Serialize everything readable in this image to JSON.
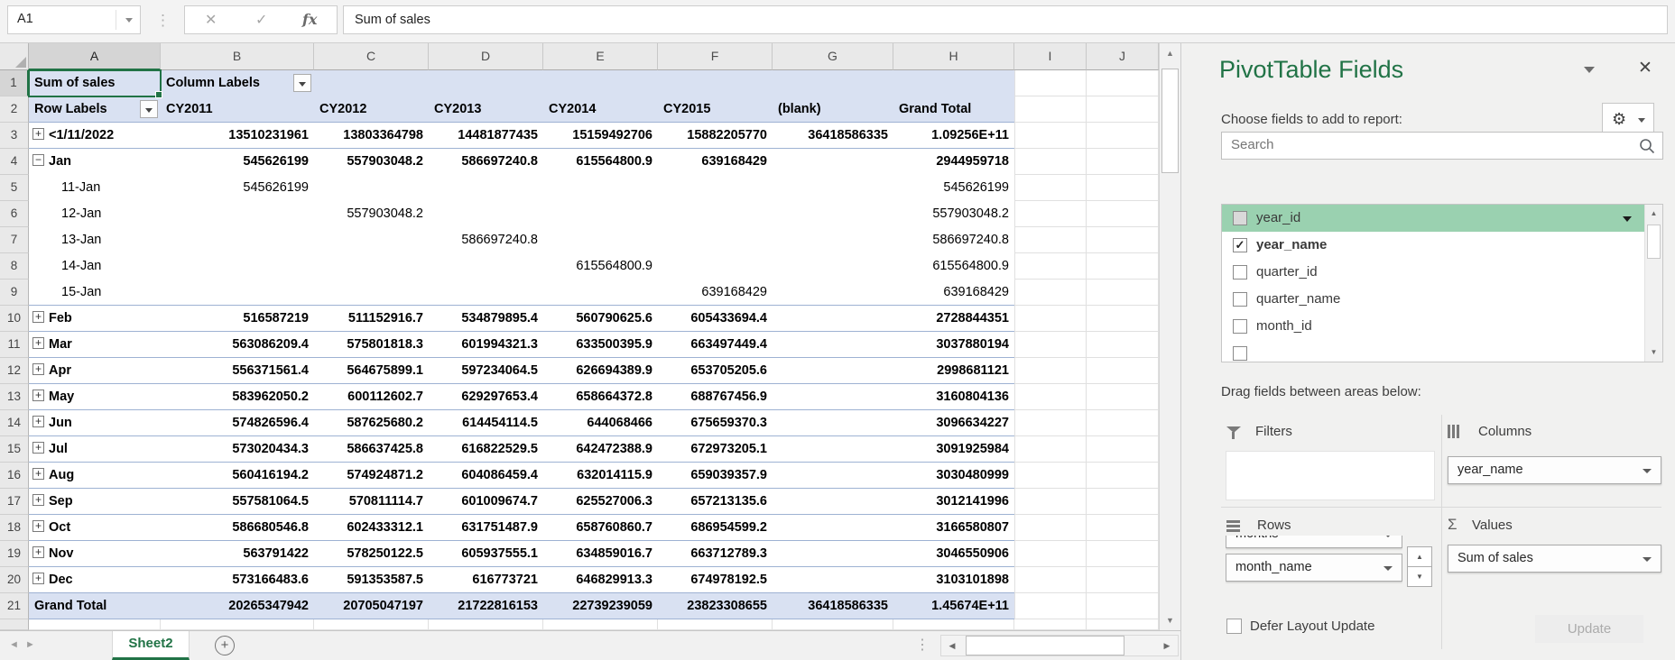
{
  "formula_bar": {
    "cell_reference": "A1",
    "formula_text": "Sum of sales",
    "fx_label": "fx"
  },
  "grid": {
    "column_letters": [
      "A",
      "B",
      "C",
      "D",
      "E",
      "F",
      "G",
      "H",
      "I",
      "J"
    ],
    "selected_column": "A",
    "selected_row": "1",
    "header_row1": {
      "row_num": "1",
      "a_value": "Sum of sales",
      "b_value": "Column Labels"
    },
    "header_row2": {
      "row_num": "2",
      "a_value": "Row Labels",
      "columns": [
        "CY2011",
        "CY2012",
        "CY2013",
        "CY2014",
        "CY2015",
        "(blank)",
        "Grand Total"
      ]
    },
    "data_rows": [
      {
        "num": "3",
        "label": "<1/11/2022",
        "expand": "plus",
        "bold": true,
        "sep": true,
        "values": [
          "13510231961",
          "13803364798",
          "14481877435",
          "15159492706",
          "15882205770",
          "36418586335",
          "1.09256E+11"
        ]
      },
      {
        "num": "4",
        "label": "Jan",
        "expand": "minus",
        "bold": true,
        "sep": false,
        "values": [
          "545626199",
          "557903048.2",
          "586697240.8",
          "615564800.9",
          "639168429",
          "",
          "2944959718"
        ]
      },
      {
        "num": "5",
        "label": "11-Jan",
        "indent": true,
        "sep": false,
        "values": [
          "545626199",
          "",
          "",
          "",
          "",
          "",
          "545626199"
        ]
      },
      {
        "num": "6",
        "label": "12-Jan",
        "indent": true,
        "sep": false,
        "values": [
          "",
          "557903048.2",
          "",
          "",
          "",
          "",
          "557903048.2"
        ]
      },
      {
        "num": "7",
        "label": "13-Jan",
        "indent": true,
        "sep": false,
        "values": [
          "",
          "",
          "586697240.8",
          "",
          "",
          "",
          "586697240.8"
        ]
      },
      {
        "num": "8",
        "label": "14-Jan",
        "indent": true,
        "sep": false,
        "values": [
          "",
          "",
          "",
          "615564800.9",
          "",
          "",
          "615564800.9"
        ]
      },
      {
        "num": "9",
        "label": "15-Jan",
        "indent": true,
        "sep": true,
        "values": [
          "",
          "",
          "",
          "",
          "639168429",
          "",
          "639168429"
        ]
      },
      {
        "num": "10",
        "label": "Feb",
        "expand": "plus",
        "bold": true,
        "sep": true,
        "values": [
          "516587219",
          "511152916.7",
          "534879895.4",
          "560790625.6",
          "605433694.4",
          "",
          "2728844351"
        ]
      },
      {
        "num": "11",
        "label": "Mar",
        "expand": "plus",
        "bold": true,
        "sep": true,
        "values": [
          "563086209.4",
          "575801818.3",
          "601994321.3",
          "633500395.9",
          "663497449.4",
          "",
          "3037880194"
        ]
      },
      {
        "num": "12",
        "label": "Apr",
        "expand": "plus",
        "bold": true,
        "sep": true,
        "values": [
          "556371561.4",
          "564675899.1",
          "597234064.5",
          "626694389.9",
          "653705205.6",
          "",
          "2998681121"
        ]
      },
      {
        "num": "13",
        "label": "May",
        "expand": "plus",
        "bold": true,
        "sep": true,
        "values": [
          "583962050.2",
          "600112602.7",
          "629297653.4",
          "658664372.8",
          "688767456.9",
          "",
          "3160804136"
        ]
      },
      {
        "num": "14",
        "label": "Jun",
        "expand": "plus",
        "bold": true,
        "sep": true,
        "values": [
          "574826596.4",
          "587625680.2",
          "614454114.5",
          "644068466",
          "675659370.3",
          "",
          "3096634227"
        ]
      },
      {
        "num": "15",
        "label": "Jul",
        "expand": "plus",
        "bold": true,
        "sep": true,
        "values": [
          "573020434.3",
          "586637425.8",
          "616822529.5",
          "642472388.9",
          "672973205.1",
          "",
          "3091925984"
        ]
      },
      {
        "num": "16",
        "label": "Aug",
        "expand": "plus",
        "bold": true,
        "sep": true,
        "values": [
          "560416194.2",
          "574924871.2",
          "604086459.4",
          "632014115.9",
          "659039357.9",
          "",
          "3030480999"
        ]
      },
      {
        "num": "17",
        "label": "Sep",
        "expand": "plus",
        "bold": true,
        "sep": true,
        "values": [
          "557581064.5",
          "570811114.7",
          "601009674.7",
          "625527006.3",
          "657213135.6",
          "",
          "3012141996"
        ]
      },
      {
        "num": "18",
        "label": "Oct",
        "expand": "plus",
        "bold": true,
        "sep": true,
        "values": [
          "586680546.8",
          "602433312.1",
          "631751487.9",
          "658760860.7",
          "686954599.2",
          "",
          "3166580807"
        ]
      },
      {
        "num": "19",
        "label": "Nov",
        "expand": "plus",
        "bold": true,
        "sep": true,
        "values": [
          "563791422",
          "578250122.5",
          "605937555.1",
          "634859016.7",
          "663712789.3",
          "",
          "3046550906"
        ]
      },
      {
        "num": "20",
        "label": "Dec",
        "expand": "plus",
        "bold": true,
        "sep": true,
        "values": [
          "573166483.6",
          "591353587.5",
          "616773721",
          "646829913.3",
          "674978192.5",
          "",
          "3103101898"
        ]
      },
      {
        "num": "21",
        "label": "Grand Total",
        "grand": true,
        "bold": true,
        "sep": true,
        "values": [
          "20265347942",
          "20705047197",
          "21722816153",
          "22739239059",
          "23823308655",
          "36418586335",
          "1.45674E+11"
        ]
      }
    ]
  },
  "sheet_bar": {
    "active_tab": "Sheet2"
  },
  "panel": {
    "title": "PivotTable Fields",
    "subtitle": "Choose fields to add to report:",
    "search_placeholder": "Search",
    "fields": [
      {
        "name": "year_id",
        "checked": false,
        "highlighted": true,
        "has_dropdown": true
      },
      {
        "name": "year_name",
        "checked": true,
        "bold": true
      },
      {
        "name": "quarter_id",
        "checked": false
      },
      {
        "name": "quarter_name",
        "checked": false
      },
      {
        "name": "month_id",
        "checked": false
      },
      {
        "name": "",
        "checked": false,
        "partial": true
      }
    ],
    "drag_label": "Drag fields between areas below:",
    "areas": {
      "filters": {
        "label": "Filters",
        "pills": []
      },
      "columns": {
        "label": "Columns",
        "pills": [
          "year_name"
        ]
      },
      "rows": {
        "label": "Rows",
        "pills": [
          "months",
          "month_name"
        ]
      },
      "values": {
        "label": "Values",
        "pills": [
          "Sum of sales"
        ]
      }
    },
    "defer_label": "Defer Layout Update",
    "update_label": "Update"
  },
  "icons": {
    "cancel": "✕",
    "enter": "✓",
    "gear": "⚙",
    "sigma": "Σ",
    "close": "✕",
    "up_arrow": "▲",
    "down_arrow": "▼",
    "left_arrow": "◀",
    "right_arrow": "▶",
    "nav_left": "◄",
    "nav_right": "►",
    "plus": "+",
    "dots": "⋮"
  },
  "colors": {
    "accent_green": "#217346",
    "pivot_header_bg": "#d9e1f2",
    "pivot_border": "#9eb2d3",
    "field_highlight": "#9ad1b0"
  }
}
